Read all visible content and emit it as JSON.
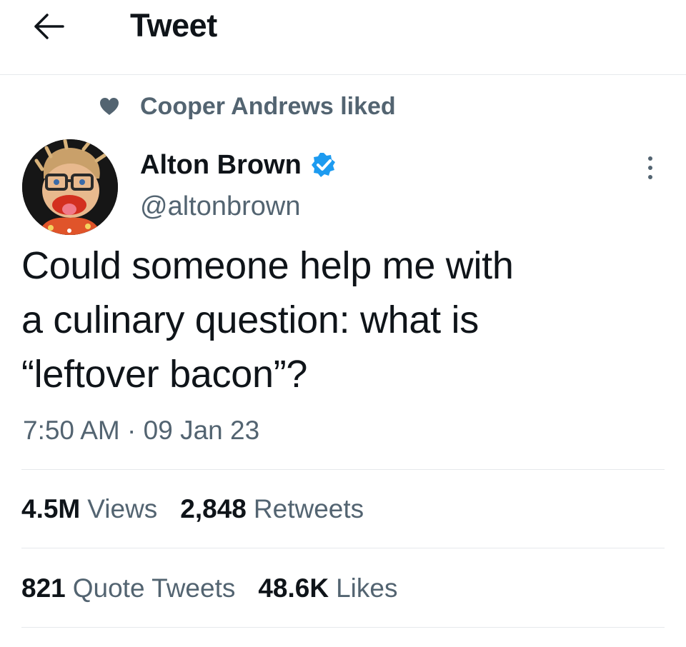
{
  "header": {
    "title": "Tweet",
    "back_icon": "arrow-left-icon"
  },
  "social_context": {
    "icon": "heart-icon",
    "text": "Cooper Andrews liked"
  },
  "author": {
    "display_name": "Alton Brown",
    "handle": "@altonbrown",
    "verified_icon": "verified-badge-icon",
    "verified_color": "#1d9bf0"
  },
  "tweet": {
    "text": "Could someone help me with\na culinary question: what is\n“leftover bacon”?",
    "time": "7:50 AM",
    "separator": "·",
    "date": "09 Jan 23"
  },
  "stats": {
    "views": {
      "count": "4.5M",
      "label": "Views"
    },
    "retweets": {
      "count": "2,848",
      "label": "Retweets"
    },
    "quote_tweets": {
      "count": "821",
      "label": "Quote Tweets"
    },
    "likes": {
      "count": "48.6K",
      "label": "Likes"
    }
  },
  "colors": {
    "text_primary": "#0f1419",
    "text_secondary": "#536471",
    "divider": "#e6e9ec"
  }
}
